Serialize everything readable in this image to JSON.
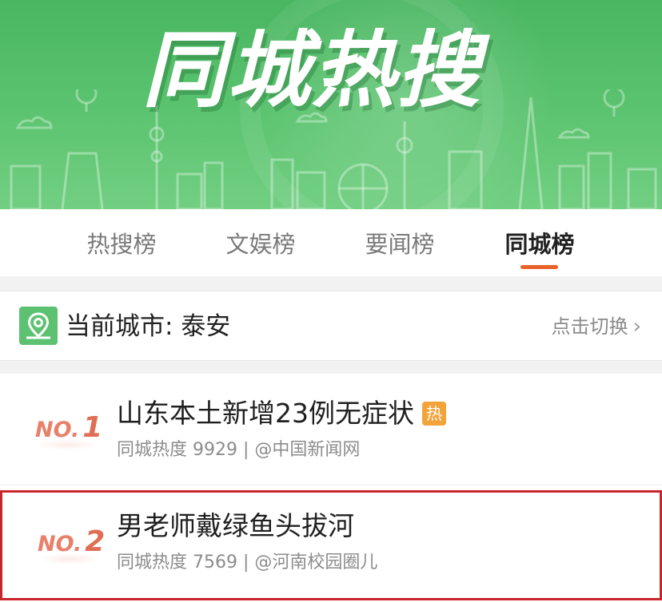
{
  "banner": {
    "title": "同城热搜"
  },
  "tabs": [
    {
      "label": "热搜榜",
      "active": false
    },
    {
      "label": "文娱榜",
      "active": false
    },
    {
      "label": "要闻榜",
      "active": false
    },
    {
      "label": "同城榜",
      "active": true
    }
  ],
  "city": {
    "label": "当前城市: 泰安",
    "switch_label": "点击切换",
    "icon": "location-pin-icon"
  },
  "list": [
    {
      "rank_prefix": "NO.",
      "rank_number": "1",
      "title": "山东本土新增23例无症状",
      "badge": "热",
      "heat_label": "同城热度",
      "heat_value": "9929",
      "separator": " | ",
      "source": "@中国新闻网"
    },
    {
      "rank_prefix": "NO.",
      "rank_number": "2",
      "title": "男老师戴绿鱼头拔河",
      "heat_label": "同城热度",
      "heat_value": "7569",
      "separator": " | ",
      "source": "@河南校园圈儿"
    }
  ],
  "colors": {
    "banner_green": "#5cc470",
    "accent_orange": "#e8622a",
    "rank_red": "#e06e55",
    "hot_badge": "#f2a33a",
    "highlight_border": "#c8262d"
  }
}
